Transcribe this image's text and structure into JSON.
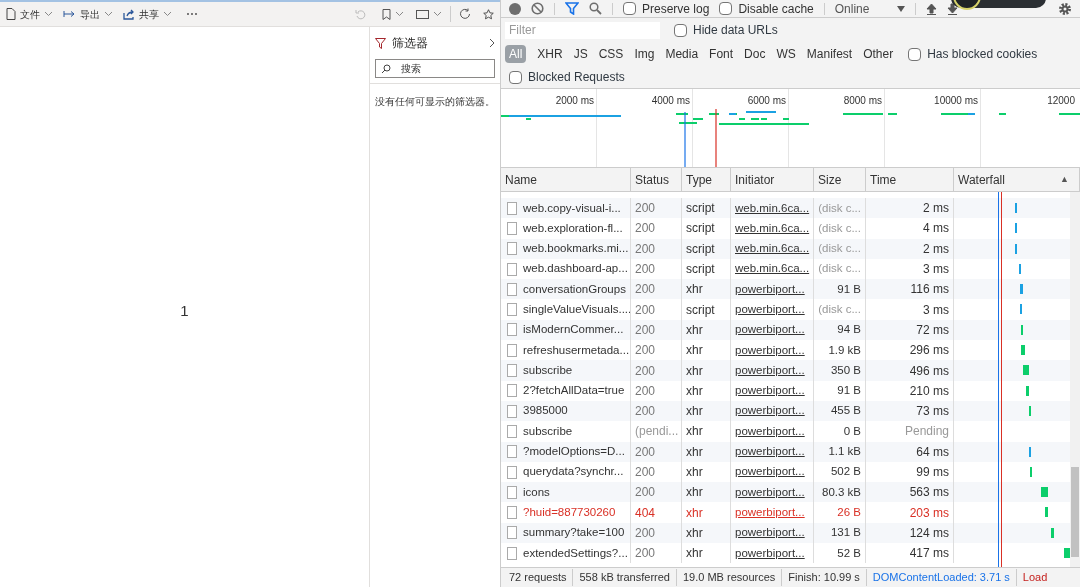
{
  "report": {
    "toolbar": [
      {
        "label": "文件",
        "kind": "menu"
      },
      {
        "label": "导出",
        "kind": "menu"
      },
      {
        "label": "共享",
        "kind": "menu"
      }
    ],
    "more": "⋯",
    "card_value": "1",
    "filters": {
      "title": "筛选器",
      "search_placeholder": "搜索",
      "empty": "没有任何可显示的筛选器。"
    }
  },
  "devtools": {
    "preserve_log": {
      "label": "Preserve log",
      "checked": false
    },
    "disable_cache": {
      "label": "Disable cache",
      "checked": false
    },
    "throttle": "Online",
    "filter_placeholder": "Filter",
    "hide_data_urls": {
      "label": "Hide data URLs",
      "checked": false
    },
    "types": [
      {
        "label": "All",
        "selected": true
      },
      {
        "label": "XHR",
        "selected": false
      },
      {
        "label": "JS",
        "selected": false
      },
      {
        "label": "CSS",
        "selected": false
      },
      {
        "label": "Img",
        "selected": false
      },
      {
        "label": "Media",
        "selected": false
      },
      {
        "label": "Font",
        "selected": false
      },
      {
        "label": "Doc",
        "selected": false
      },
      {
        "label": "WS",
        "selected": false
      },
      {
        "label": "Manifest",
        "selected": false
      },
      {
        "label": "Other",
        "selected": false
      }
    ],
    "has_blocked_cookies": {
      "label": "Has blocked cookies",
      "checked": false
    },
    "blocked_requests": {
      "label": "Blocked Requests",
      "checked": false
    },
    "ticks": [
      "2000 ms",
      "4000 ms",
      "6000 ms",
      "8000 ms",
      "10000 ms",
      "12000"
    ],
    "columns": [
      "Name",
      "Status",
      "Type",
      "Initiator",
      "Size",
      "Time",
      "Waterfall"
    ],
    "sort_icon": "▲",
    "rows": [
      {
        "name": "web.copy-visual-i...",
        "status": "200",
        "type": "script",
        "initiator": "web.min.6ca...",
        "size": "(disk c...",
        "time": "2 ms",
        "failed": false
      },
      {
        "name": "web.exploration-fl...",
        "status": "200",
        "type": "script",
        "initiator": "web.min.6ca...",
        "size": "(disk c...",
        "time": "4 ms",
        "failed": false
      },
      {
        "name": "web.bookmarks.mi...",
        "status": "200",
        "type": "script",
        "initiator": "web.min.6ca...",
        "size": "(disk c...",
        "time": "2 ms",
        "failed": false
      },
      {
        "name": "web.dashboard-ap...",
        "status": "200",
        "type": "script",
        "initiator": "web.min.6ca...",
        "size": "(disk c...",
        "time": "3 ms",
        "failed": false
      },
      {
        "name": "conversationGroups",
        "status": "200",
        "type": "xhr",
        "initiator": "powerbiport...",
        "size": "91 B",
        "time": "116 ms",
        "failed": false
      },
      {
        "name": "singleValueVisuals....",
        "status": "200",
        "type": "script",
        "initiator": "powerbiport...",
        "size": "(disk c...",
        "time": "3 ms",
        "failed": false
      },
      {
        "name": "isModernCommer...",
        "status": "200",
        "type": "xhr",
        "initiator": "powerbiport...",
        "size": "94 B",
        "time": "72 ms",
        "failed": false
      },
      {
        "name": "refreshusermetada...",
        "status": "200",
        "type": "xhr",
        "initiator": "powerbiport...",
        "size": "1.9 kB",
        "time": "296 ms",
        "failed": false
      },
      {
        "name": "subscribe",
        "status": "200",
        "type": "xhr",
        "initiator": "powerbiport...",
        "size": "350 B",
        "time": "496 ms",
        "failed": false
      },
      {
        "name": "2?fetchAllData=true",
        "status": "200",
        "type": "xhr",
        "initiator": "powerbiport...",
        "size": "91 B",
        "time": "210 ms",
        "failed": false
      },
      {
        "name": "3985000",
        "status": "200",
        "type": "xhr",
        "initiator": "powerbiport...",
        "size": "455 B",
        "time": "73 ms",
        "failed": false
      },
      {
        "name": "subscribe",
        "status": "(pendi...",
        "type": "xhr",
        "initiator": "powerbiport...",
        "size": "0 B",
        "time": "Pending",
        "failed": false
      },
      {
        "name": "?modelOptions=D...",
        "status": "200",
        "type": "xhr",
        "initiator": "powerbiport...",
        "size": "1.1 kB",
        "time": "64 ms",
        "failed": false
      },
      {
        "name": "querydata?synchr...",
        "status": "200",
        "type": "xhr",
        "initiator": "powerbiport...",
        "size": "502 B",
        "time": "99 ms",
        "failed": false
      },
      {
        "name": "icons",
        "status": "200",
        "type": "xhr",
        "initiator": "powerbiport...",
        "size": "80.3 kB",
        "time": "563 ms",
        "failed": false
      },
      {
        "name": "?huid=887730260",
        "status": "404",
        "type": "xhr",
        "initiator": "powerbiport...",
        "size": "26 B",
        "time": "203 ms",
        "failed": true
      },
      {
        "name": "summary?take=100",
        "status": "200",
        "type": "xhr",
        "initiator": "powerbiport...",
        "size": "131 B",
        "time": "124 ms",
        "failed": false
      },
      {
        "name": "extendedSettings?...",
        "status": "200",
        "type": "xhr",
        "initiator": "powerbiport...",
        "size": "52 B",
        "time": "417 ms",
        "failed": false
      }
    ],
    "status_bar": [
      {
        "text": "72 requests",
        "kind": "plain"
      },
      {
        "text": "558 kB transferred",
        "kind": "plain"
      },
      {
        "text": "19.0 MB resources",
        "kind": "plain"
      },
      {
        "text": "Finish: 10.99 s",
        "kind": "plain"
      },
      {
        "text": "DOMContentLoaded: 3.71 s",
        "kind": "dcl"
      },
      {
        "text": "Load",
        "kind": "load"
      }
    ]
  }
}
